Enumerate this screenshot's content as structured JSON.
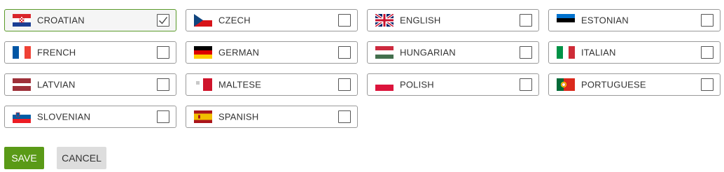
{
  "languages": [
    {
      "label": "CROATIAN",
      "flag": "croatia-flag-icon",
      "selected": true
    },
    {
      "label": "CZECH",
      "flag": "czech-flag-icon",
      "selected": false
    },
    {
      "label": "ENGLISH",
      "flag": "uk-flag-icon",
      "selected": false
    },
    {
      "label": "ESTONIAN",
      "flag": "estonia-flag-icon",
      "selected": false
    },
    {
      "label": "FRENCH",
      "flag": "france-flag-icon",
      "selected": false
    },
    {
      "label": "GERMAN",
      "flag": "germany-flag-icon",
      "selected": false
    },
    {
      "label": "HUNGARIAN",
      "flag": "hungary-flag-icon",
      "selected": false
    },
    {
      "label": "ITALIAN",
      "flag": "italy-flag-icon",
      "selected": false
    },
    {
      "label": "LATVIAN",
      "flag": "latvia-flag-icon",
      "selected": false
    },
    {
      "label": "MALTESE",
      "flag": "malta-flag-icon",
      "selected": false
    },
    {
      "label": "POLISH",
      "flag": "poland-flag-icon",
      "selected": false
    },
    {
      "label": "PORTUGUESE",
      "flag": "portugal-flag-icon",
      "selected": false
    },
    {
      "label": "SLOVENIAN",
      "flag": "slovenia-flag-icon",
      "selected": false
    },
    {
      "label": "SPANISH",
      "flag": "spain-flag-icon",
      "selected": false
    }
  ],
  "actions": {
    "save_label": "SAVE",
    "cancel_label": "CANCEL"
  },
  "colors": {
    "save_button": "#5a9a17",
    "cancel_button": "#dddddd",
    "selected_border": "#5a9a2a"
  }
}
